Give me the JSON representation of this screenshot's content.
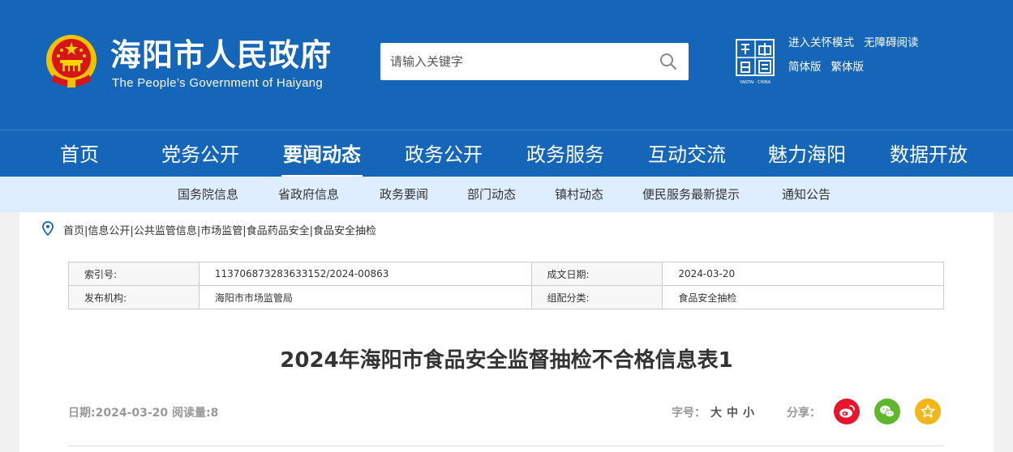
{
  "header": {
    "site_name_cn": "海阳市人民政府",
    "site_name_en": "The People’s Government of Haiyang",
    "search_placeholder": "请输入关键字",
    "top_links": [
      "进入关怀模式",
      "无障碍阅读",
      "简体版",
      "繁体版"
    ],
    "seal_text": "YANTAI · CHINA"
  },
  "main_nav": [
    {
      "label": "首页",
      "active": false
    },
    {
      "label": "党务公开",
      "active": false
    },
    {
      "label": "要闻动态",
      "active": true
    },
    {
      "label": "政务公开",
      "active": false
    },
    {
      "label": "政务服务",
      "active": false
    },
    {
      "label": "互动交流",
      "active": false
    },
    {
      "label": "魅力海阳",
      "active": false
    },
    {
      "label": "数据开放",
      "active": false
    }
  ],
  "sub_nav": [
    "国务院信息",
    "省政府信息",
    "政务要闻",
    "部门动态",
    "镇村动态",
    "便民服务最新提示",
    "通知公告"
  ],
  "breadcrumb": [
    "首页",
    "信息公开",
    "公共监管信息",
    "市场监管",
    "食品药品安全",
    "食品安全抽检"
  ],
  "meta": {
    "index_label": "索引号:",
    "index_value": "113706873283633152/2024-00863",
    "date_label": "成文日期:",
    "date_value": "2024-03-20",
    "org_label": "发布机构:",
    "org_value": "海阳市市场监管局",
    "category_label": "组配分类:",
    "category_value": "食品安全抽检"
  },
  "article": {
    "title": "2024年海阳市食品安全监督抽检不合格信息表1",
    "date_line": "日期:2024-03-20 阅读量:8",
    "font_size_label": "字号：",
    "font_sizes": [
      "大",
      "中",
      "小"
    ],
    "share_label": "分享："
  },
  "colors": {
    "brand_blue": "#1565b8",
    "subnav_bg": "#dfeeff",
    "weibo": "#e6162d",
    "wechat": "#5fb72c",
    "favorite": "#f3b619"
  }
}
